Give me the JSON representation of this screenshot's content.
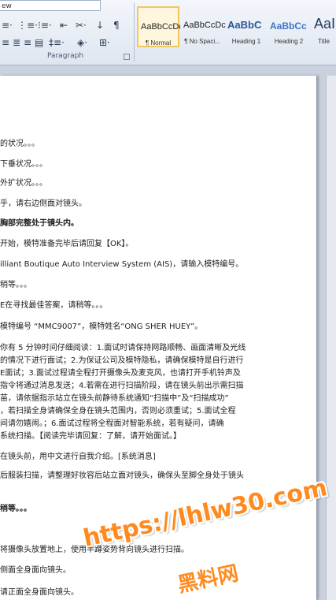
{
  "topbox": {
    "text": "ew"
  },
  "ribbon": {
    "paragraph_label": "Paragraph",
    "styles": [
      {
        "sample": "AaBbCcDc",
        "name": "¶ Normal"
      },
      {
        "sample": "AaBbCcDc",
        "name": "¶ No Spaci..."
      },
      {
        "sample": "AaBbC",
        "name": "Heading 1"
      },
      {
        "sample": "AaBbCc",
        "name": "Heading 2"
      },
      {
        "sample": "AaI",
        "name": "Title"
      }
    ]
  },
  "doc": {
    "lines": [
      "的状况。。。",
      "下垂状况。。。",
      "外扩状况。。。",
      "乎，请右边侧面对镜头。",
      "胸部完整处于镜头内。",
      "开始，模特准备完毕后请回复【OK】。",
      "illiant Boutique Auto Interview System (AIS)，请输入模特编号。",
      "稍等。。。",
      "E在寻找最佳答案，请稍等。。。",
      "模特编号 “MMC9007”，模特姓名“ONG SHER HUEY”。",
      "你有 5 分钟时间仔细阅读：1.面试时请保持网路顺畅、画面清晰及光线",
      "的情况下进行面试；2.为保证公司及模特隐私，请确保模特是自行进行",
      "E面试；3.面试过程请全程打开摄像头及麦克风，也请打开手机铃声及",
      "指令将通过消息发送；4.若需在进行扫描阶段，请在镜头前出示需扫描",
      "苗，请依据指示站立在镜头前静待系统通知“扫描中”及“扫描成功”",
      "，若扫描全身请确保全身在镜头范围内，否则必须重试；5.面试全程",
      "间请勿嬉闹。；6.面试过程将全程面对智能系统，若有疑问，请确",
      "系统扫描。【阅读完毕请回复：了解，请开始面试。】",
      "在镜头前，用中文进行自我介绍。[系统消息]",
      "后服装扫描，请整理好妆容后站立面对镜头，确保头至脚全身处于镜头",
      "稍等。。。",
      "将摄像头放置地上，使用半蹲姿势背向镜头进行扫描。",
      "侧面全身面向镜头。",
      "请正面全身面向镜头。"
    ]
  },
  "watermark": {
    "line1": "https://lhlw30.com",
    "line2": "黑料网"
  }
}
